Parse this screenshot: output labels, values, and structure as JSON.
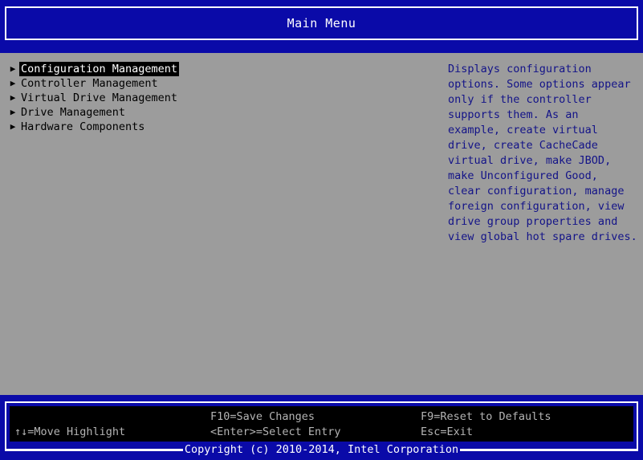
{
  "header": {
    "title": "Main Menu"
  },
  "menu": {
    "arrow_glyph": "▶",
    "items": [
      {
        "label": "Configuration Management",
        "selected": true
      },
      {
        "label": "Controller Management",
        "selected": false
      },
      {
        "label": "Virtual Drive Management",
        "selected": false
      },
      {
        "label": "Drive Management",
        "selected": false
      },
      {
        "label": "Hardware Components",
        "selected": false
      }
    ]
  },
  "help": {
    "lines": [
      "Displays configuration",
      "options. Some options appear",
      "only if the controller",
      "supports them. As an",
      "example, create virtual",
      "drive, create CacheCade",
      "virtual drive, make JBOD,",
      "make Unconfigured Good,",
      "clear configuration, manage",
      "foreign configuration, view",
      "drive group properties and",
      "view global hot spare drives."
    ]
  },
  "footer": {
    "hotkeys": {
      "move_highlight": "↑↓=Move Highlight",
      "save_changes": "F10=Save Changes",
      "select_entry": "<Enter>=Select Entry",
      "reset_defaults": "F9=Reset to Defaults",
      "exit": "Esc=Exit"
    },
    "copyright": "Copyright (c) 2010-2014, Intel Corporation"
  },
  "colors": {
    "background_gray": "#9c9c9c",
    "band_blue": "#0a0aa8",
    "help_text_blue": "#131388",
    "selection_background": "#000000",
    "selection_text": "#ffffff",
    "hotkey_text": "#b4b4b4"
  }
}
